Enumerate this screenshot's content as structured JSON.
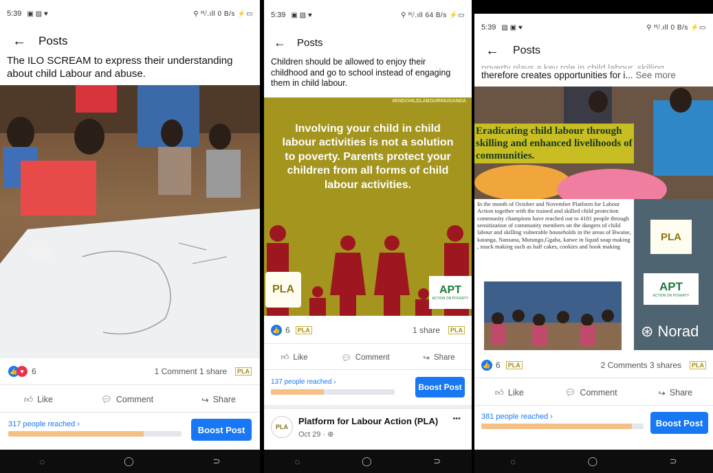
{
  "screens": [
    {
      "status_time": "5:39",
      "status_right": "⚲ ᴴᵢˡ.ıll 0 B/s ⚡▭",
      "title": "Posts",
      "caption": "The ILO SCREAM to express their understanding about child Labour and abuse.",
      "reaction_count": "6",
      "engagement": "1 Comment 1 share",
      "actions": [
        "Like",
        "Comment",
        "Share"
      ],
      "reached": "317 people reached ›",
      "reach_progress": 0.78,
      "boost_label": "Boost Post"
    },
    {
      "status_time": "5:39",
      "status_right": "⚲ ᴴᵢˡ.ıll 64 B/s ⚡▭",
      "title": "Posts",
      "caption": "Children should be allowed  to enjoy their childhood and go to school instead of engaging them in child labour.",
      "hashtag": "#ENDCHILDLABOURINUGANDA",
      "poster_text": "Involving your child in child labour activities is not a solution to poverty. Parents protect your children from all forms of child labour activities.",
      "pla_logo": "PLA",
      "apt_logo": "APT",
      "apt_sub": "ACTION ON POVERTY",
      "reaction_count": "6",
      "engagement": "1 share",
      "actions": [
        "Like",
        "Comment",
        "Share"
      ],
      "reached": "137 people reached ›",
      "reach_progress": 0.43,
      "boost_label": "Boost Post",
      "page_name": "Platform for Labour Action (PLA)",
      "post_date": "Oct 29 · ",
      "more_icon": "•••"
    },
    {
      "status_time": "5:39",
      "status_right": "⚲ ᴴᵢˡ.ıll 0 B/s ⚡▭",
      "title": "Posts",
      "caption_cut": "poverty plays a key role in child labour, skilling",
      "caption": "therefore creates opportunities for i...",
      "see_more": "See more",
      "banner": "Eradicating child labour through skilling and enhanced livelihoods of communities.",
      "body": "In the month of October and November Platform for Labour Action together with the trained and skilled child protection community champions have reached out to 4181 people through  sensitization of community members on the dangers of child labour and skilling vulnerable households in the areas of Bwaise, katanga, Nansana, Mutungo,Ggaba, katwe in liquid soap making , snack making  such as half cakes, cookies and book making",
      "pla_logo": "PLA",
      "apt_logo": "APT",
      "apt_sub": "ACTION ON POVERTY",
      "norad": "Norad",
      "reaction_count": "6",
      "engagement": "2 Comments 3 shares",
      "actions": [
        "Like",
        "Comment",
        "Share"
      ],
      "reached": "381 people reached ›",
      "reach_progress": 0.93,
      "boost_label": "Boost Post"
    }
  ],
  "colors": {
    "facebook_blue": "#1877f2",
    "poster_olive": "#a3951e",
    "poster_maroon": "#9e1620",
    "reach_fill": "#f5c086"
  }
}
